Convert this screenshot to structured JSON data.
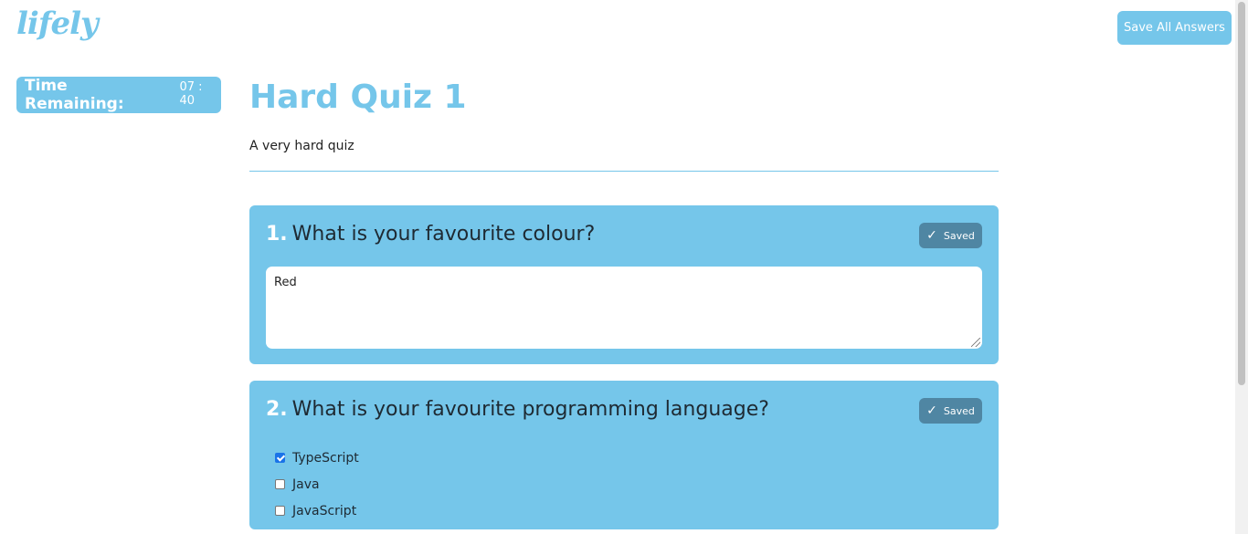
{
  "header": {
    "logo": "lifely",
    "save_all_label": "Save All Answers"
  },
  "timer": {
    "label": "Time Remaining:",
    "value": "07 : 40"
  },
  "quiz": {
    "title": "Hard Quiz 1",
    "description": "A very hard quiz"
  },
  "questions": [
    {
      "number": "1.",
      "text": "What is your favourite colour?",
      "status": "Saved",
      "answer": "Red"
    },
    {
      "number": "2.",
      "text": "What is your favourite programming language?",
      "status": "Saved",
      "options": [
        {
          "label": "TypeScript",
          "checked": true
        },
        {
          "label": "Java",
          "checked": false
        },
        {
          "label": "JavaScript",
          "checked": false
        }
      ]
    }
  ],
  "colors": {
    "accent": "#75c6ea",
    "badge": "#4f86a3"
  }
}
